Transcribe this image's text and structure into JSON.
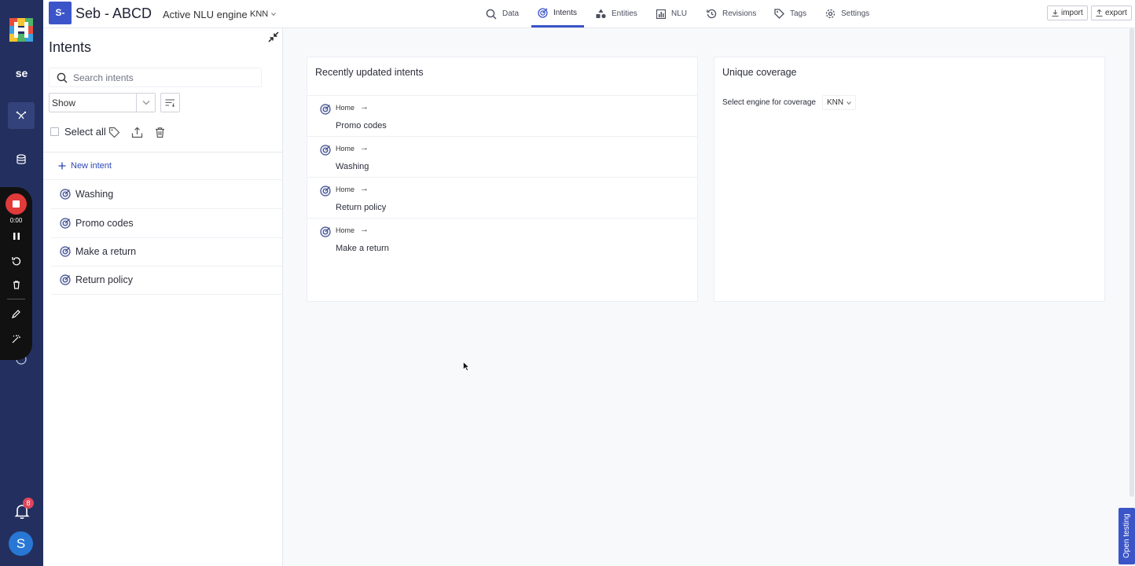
{
  "rail": {
    "workspace_initials": "se",
    "notification_count": "8",
    "avatar_letter": "S",
    "colors": {
      "background": "#23305f",
      "active_item": "#33427a",
      "badge": "#e0455a",
      "avatar": "#2877d5"
    }
  },
  "recorder": {
    "time": "0:00"
  },
  "header": {
    "project_badge": "S-",
    "project_name": "Seb - ABCD",
    "engine_label": "Active NLU engine",
    "engine_value": "KNN",
    "tabs": [
      {
        "label": "Data",
        "icon": "search-icon"
      },
      {
        "label": "Intents",
        "icon": "target-icon",
        "active": true
      },
      {
        "label": "Entities",
        "icon": "shapes-icon"
      },
      {
        "label": "NLU",
        "icon": "bar-chart-icon"
      },
      {
        "label": "Revisions",
        "icon": "history-icon"
      },
      {
        "label": "Tags",
        "icon": "tag-icon"
      },
      {
        "label": "Settings",
        "icon": "gear-icon"
      }
    ],
    "import_label": "import",
    "export_label": "export",
    "accent_color": "#3b55c9"
  },
  "left_panel": {
    "title": "Intents",
    "search_placeholder": "Search intents",
    "show_select_value": "Show",
    "select_all_label": "Select all",
    "new_intent_label": "New intent",
    "intents": [
      "Washing",
      "Promo codes",
      "Make a return",
      "Return policy"
    ]
  },
  "recent": {
    "title": "Recently updated intents",
    "items": [
      {
        "crumb": "Home",
        "name": "Promo codes"
      },
      {
        "crumb": "Home",
        "name": "Washing"
      },
      {
        "crumb": "Home",
        "name": "Return policy"
      },
      {
        "crumb": "Home",
        "name": "Make a return"
      }
    ]
  },
  "coverage": {
    "title": "Unique coverage",
    "engine_label": "Select engine for coverage",
    "engine_value": "KNN"
  },
  "open_testing_label": "Open testing"
}
